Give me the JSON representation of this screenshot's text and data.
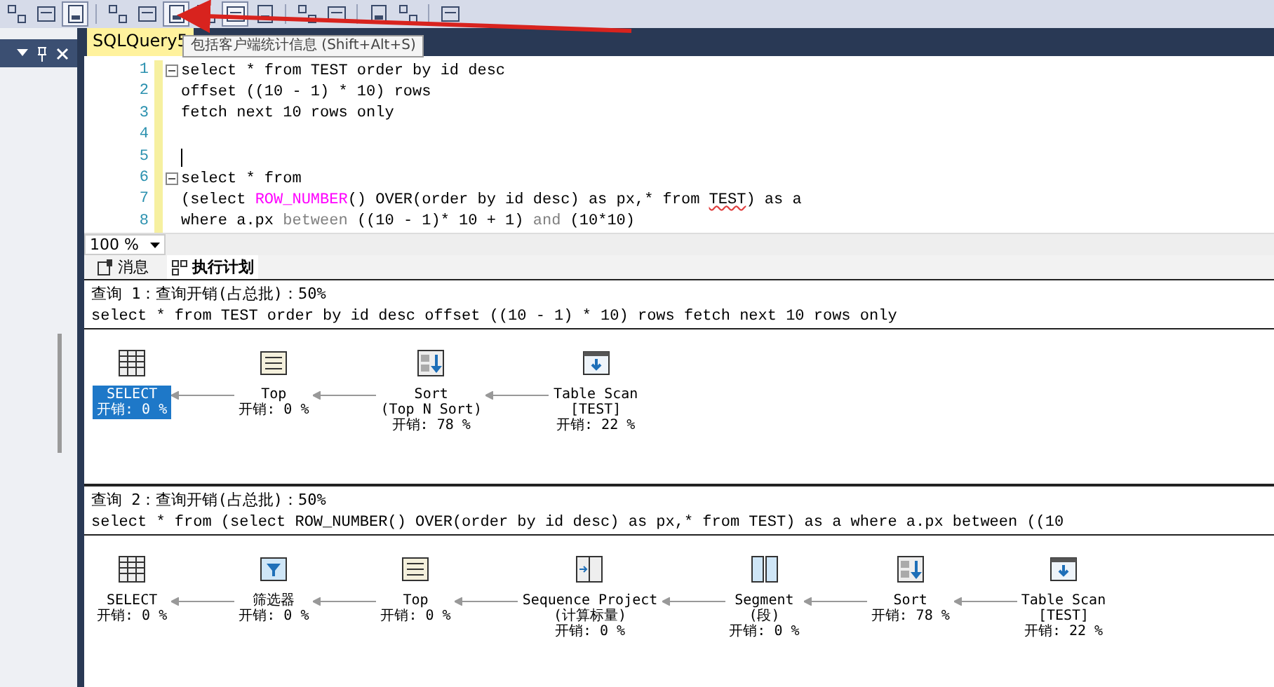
{
  "toolbar_buttons": [
    {
      "pressed": false
    },
    {
      "pressed": false
    },
    {
      "pressed": true
    },
    {
      "pressed": false
    },
    {
      "pressed": false
    },
    {
      "pressed": true
    },
    {
      "pressed": false
    },
    {
      "pressed": true
    },
    {
      "pressed": false
    },
    {
      "pressed": false
    },
    {
      "pressed": false
    },
    {
      "pressed": false
    },
    {
      "pressed": false
    },
    {
      "pressed": false
    }
  ],
  "tooltip": "包括客户端统计信息 (Shift+Alt+S)",
  "document_tab": {
    "label": "SQLQuery5",
    "selected": true
  },
  "editor": {
    "lines": [
      {
        "number": "1",
        "fold": true,
        "segments": [
          {
            "kind": "plain",
            "text": "select * from TEST order by id desc"
          }
        ]
      },
      {
        "number": "2",
        "fold": false,
        "segments": [
          {
            "kind": "plain",
            "text": "offset ((10 - 1) * 10) rows"
          }
        ]
      },
      {
        "number": "3",
        "fold": false,
        "segments": [
          {
            "kind": "plain",
            "text": "fetch next 10 rows only"
          }
        ]
      },
      {
        "number": "4",
        "fold": false
      },
      {
        "number": "5",
        "fold": false,
        "cursor": true
      },
      {
        "number": "6",
        "fold": true,
        "segments": [
          {
            "kind": "plain",
            "text": "select * from"
          }
        ]
      },
      {
        "number": "7",
        "fold": false,
        "segments": [
          {
            "kind": "plain",
            "text": "(select "
          },
          {
            "kind": "function",
            "text": "ROW_NUMBER"
          },
          {
            "kind": "plain",
            "text": "() OVER(order by id desc) as px,* from "
          },
          {
            "kind": "error",
            "text": "TEST"
          },
          {
            "kind": "plain",
            "text": ") as a"
          }
        ]
      },
      {
        "number": "8",
        "fold": false,
        "segments": [
          {
            "kind": "plain",
            "text": "where a.px "
          },
          {
            "kind": "operator",
            "text": "between"
          },
          {
            "kind": "plain",
            "text": " ((10 - 1)* 10 + 1) "
          },
          {
            "kind": "operator",
            "text": "and"
          },
          {
            "kind": "plain",
            "text": " (10*10)"
          }
        ]
      }
    ]
  },
  "zoom": "100 %",
  "result_tabs": [
    {
      "label": "消息",
      "kind": "messages",
      "selected": false
    },
    {
      "label": "执行计划",
      "kind": "plan",
      "selected": true
    }
  ],
  "plans": [
    {
      "header": "查询 1：查询开销(占总批)：50%",
      "sql": "select * from TEST order by id desc offset ((10 - 1) * 10) rows fetch next 10 rows only",
      "nodes": [
        {
          "kind": "select",
          "lines": [
            "SELECT",
            "开销: 0 %"
          ],
          "selected": true
        },
        {
          "kind": "top",
          "lines": [
            "Top",
            "开销: 0 %"
          ],
          "selected": false
        },
        {
          "kind": "sort",
          "lines": [
            "Sort",
            "(Top N Sort)",
            "开销: 78 %"
          ],
          "selected": false
        },
        {
          "kind": "scan",
          "lines": [
            "Table Scan",
            "[TEST]",
            "开销: 22 %"
          ],
          "selected": false
        }
      ]
    },
    {
      "header": "查询 2：查询开销(占总批)：50%",
      "sql": "select * from (select ROW_NUMBER() OVER(order by id desc) as px,* from TEST) as a where a.px between ((10",
      "nodes": [
        {
          "kind": "select",
          "lines": [
            "SELECT",
            "开销: 0 %"
          ],
          "selected": false
        },
        {
          "kind": "filter",
          "lines": [
            "筛选器",
            "开销: 0 %"
          ],
          "selected": false
        },
        {
          "kind": "top",
          "lines": [
            "Top",
            "开销: 0 %"
          ],
          "selected": false
        },
        {
          "kind": "sequence",
          "lines": [
            "Sequence Project",
            "(计算标量)",
            "开销: 0 %"
          ],
          "selected": false
        },
        {
          "kind": "segment",
          "lines": [
            "Segment",
            "(段)",
            "开销: 0 %"
          ],
          "selected": false
        },
        {
          "kind": "sort",
          "lines": [
            "Sort",
            "开销: 78 %"
          ],
          "selected": false
        },
        {
          "kind": "scan",
          "lines": [
            "Table Scan",
            "[TEST]",
            "开销: 22 %"
          ],
          "selected": false
        }
      ]
    }
  ]
}
